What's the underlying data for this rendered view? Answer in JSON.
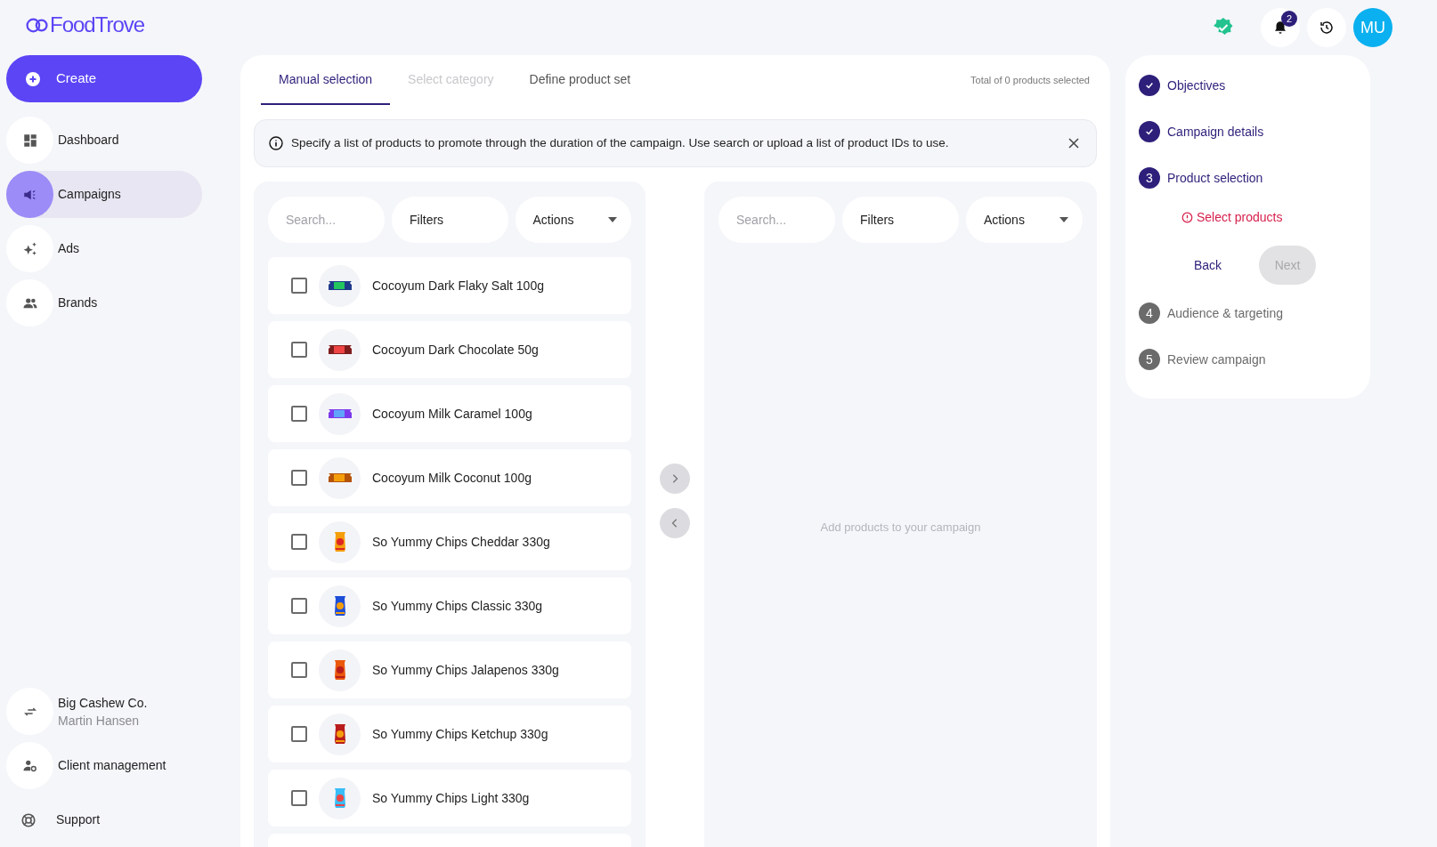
{
  "brand": {
    "name": "FoodTrove"
  },
  "sidebar": {
    "create": {
      "label": "Create"
    },
    "items": [
      {
        "kind": "dashboard",
        "label": "Dashboard",
        "selected": false
      },
      {
        "kind": "megaphone",
        "label": "Campaigns",
        "selected": true
      },
      {
        "kind": "sparkles",
        "label": "Ads",
        "selected": false
      },
      {
        "kind": "people",
        "label": "Brands",
        "selected": false
      }
    ],
    "account": {
      "company": "Big Cashew Co.",
      "user": "Martin Hansen"
    },
    "footer_items": [
      {
        "kind": "user-gear",
        "label": "Client management"
      },
      {
        "kind": "lifebuoy",
        "label": "Support"
      }
    ]
  },
  "header": {
    "notifications": "2",
    "avatar": "MU"
  },
  "tabs": [
    {
      "label": "Manual selection",
      "selected": true,
      "disabled": false
    },
    {
      "label": "Select category",
      "selected": false,
      "disabled": true
    },
    {
      "label": "Define product set",
      "selected": false,
      "disabled": false
    }
  ],
  "total": "Total of 0 products selected",
  "info": "Specify a list of products to promote through the duration of the campaign. Use search or upload a list of product IDs to use.",
  "left_panel": {
    "search": {
      "placeholder": "Search..."
    },
    "filters": "Filters",
    "actions": "Actions",
    "products": [
      {
        "name": "Cocoyum Dark Flaky Salt 100g",
        "checked": false
      },
      {
        "name": "Cocoyum Dark Chocolate 50g",
        "checked": false
      },
      {
        "name": "Cocoyum Milk Caramel 100g",
        "checked": false
      },
      {
        "name": "Cocoyum Milk Coconut 100g",
        "checked": false
      },
      {
        "name": "So Yummy Chips Cheddar 330g",
        "checked": false
      },
      {
        "name": "So Yummy Chips Classic 330g",
        "checked": false
      },
      {
        "name": "So Yummy Chips Jalapenos 330g",
        "checked": false
      },
      {
        "name": "So Yummy Chips Ketchup 330g",
        "checked": false
      },
      {
        "name": "So Yummy Chips Light 330g",
        "checked": false
      }
    ]
  },
  "right_panel": {
    "search": {
      "placeholder": "Search..."
    },
    "filters": "Filters",
    "actions": "Actions",
    "empty": "Add products to your campaign"
  },
  "steps": [
    {
      "kind": "done",
      "label": "Objectives"
    },
    {
      "kind": "done",
      "label": "Campaign details"
    },
    {
      "kind": "current",
      "number": "3",
      "label": "Product selection",
      "error": "Select products",
      "back": "Back",
      "next": "Next",
      "next_disabled": true
    },
    {
      "kind": "upcoming",
      "number": "4",
      "label": "Audience & targeting"
    },
    {
      "kind": "upcoming",
      "number": "5",
      "label": "Review campaign"
    }
  ]
}
